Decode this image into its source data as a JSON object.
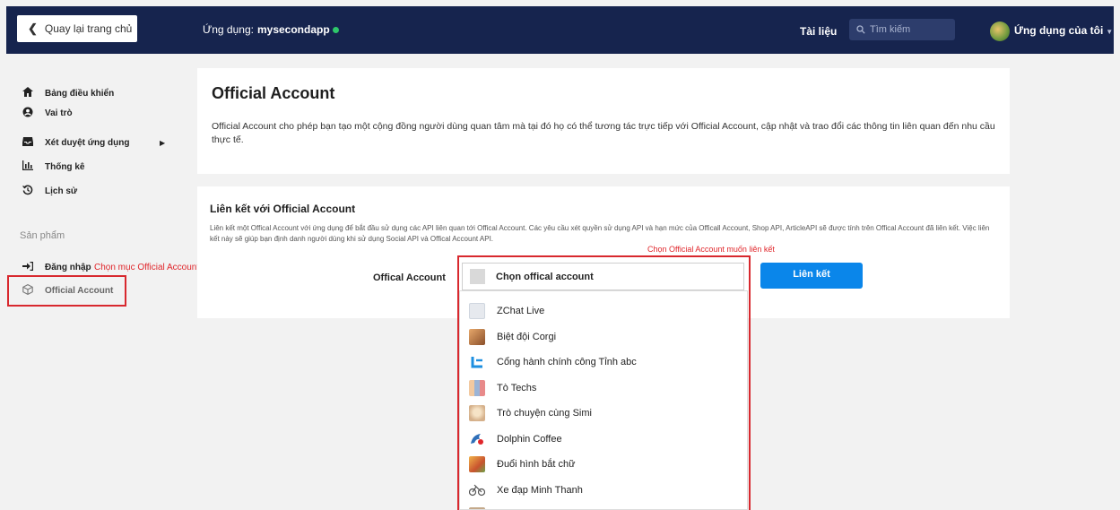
{
  "topbar": {
    "back_label": "Quay lại trang chủ",
    "app_prefix": "Ứng dụng:",
    "app_name": "mysecondapp",
    "docs": "Tài liệu",
    "search_placeholder": "Tìm kiếm",
    "my_apps": "Ứng dụng của tôi"
  },
  "sidebar": {
    "items": [
      {
        "label": "Bảng điều khiển",
        "icon": "home-icon"
      },
      {
        "label": "Vai trò",
        "icon": "user-circle-icon"
      },
      {
        "label": "Xét duyệt ứng dụng",
        "icon": "inbox-icon"
      },
      {
        "label": "Thống kê",
        "icon": "bar-chart-icon"
      },
      {
        "label": "Lịch sử",
        "icon": "history-icon"
      }
    ],
    "section": "Sản phẩm",
    "product_items": [
      {
        "label": "Đăng nhập",
        "icon": "login-icon"
      },
      {
        "label": "Official Account",
        "icon": "cube-icon"
      }
    ],
    "annotation": "Chọn mục Official Account"
  },
  "intro_card": {
    "title": "Official Account",
    "description": "Official Account cho phép bạn tạo một cộng đồng người dùng quan tâm mà tại đó họ có thể tương tác trực tiếp với Official Account, cập nhật và trao đổi các thông tin liên quan đến nhu cầu thực tế."
  },
  "link_card": {
    "title": "Liên kết với Official Account",
    "description": "Liên kết một Offical Account với ứng dụng để bắt đầu sử dụng các API liên quan tới Offical Account. Các yêu cầu xét quyền sử dụng API và hạn mức của Officall Account, Shop API, ArticleAPI sẽ được tính trên Offical Account đã liên kết. Việc liên kết này sẽ giúp bạn định danh người dùng khi sử dụng Social API và Offical Account API.",
    "field_label": "Offical Account",
    "select_placeholder": "Chọn offical account",
    "link_button": "Liên kết",
    "annotation": "Chọn Official Account muốn liên kết"
  },
  "dropdown": {
    "options": [
      {
        "label": "ZChat Live",
        "color": "#e6e9ee"
      },
      {
        "label": "Biệt đội Corgi",
        "color": "#c9824a"
      },
      {
        "label": "Cổng hành chính công Tỉnh abc",
        "color": "#1d8fe0"
      },
      {
        "label": "Tò Techs",
        "color": "#8fa3c4"
      },
      {
        "label": "Trò chuyện cùng Simi",
        "color": "#e9c9a4"
      },
      {
        "label": "Dolphin Coffee",
        "color": "#2f6fb8"
      },
      {
        "label": "Đuổi hình bắt chữ",
        "color": "#d98a3a"
      },
      {
        "label": "Xe đạp Minh Thanh",
        "color": "#777777"
      }
    ]
  },
  "colors": {
    "topbar": "#16244e",
    "primary": "#0a86ea",
    "annotation_red": "#e0262b",
    "online": "#2ec76a"
  }
}
